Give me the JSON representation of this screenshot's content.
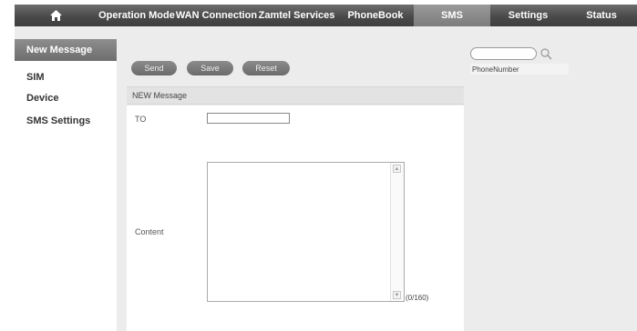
{
  "nav": {
    "items": [
      {
        "label": "Operation Mode"
      },
      {
        "label": "WAN Connection"
      },
      {
        "label": "Zamtel Services"
      },
      {
        "label": "PhoneBook"
      },
      {
        "label": "SMS"
      },
      {
        "label": "Settings"
      },
      {
        "label": "Status"
      }
    ],
    "active_index": 4
  },
  "sidebar": {
    "items": [
      {
        "label": "New Message"
      },
      {
        "label": "SIM"
      },
      {
        "label": "Device"
      },
      {
        "label": "SMS Settings"
      }
    ],
    "active_index": 0
  },
  "toolbar": {
    "send_label": "Send",
    "save_label": "Save",
    "reset_label": "Reset"
  },
  "form": {
    "section_title": "NEW Message",
    "to_label": "TO",
    "to_value": "",
    "content_label": "Content",
    "content_value": "",
    "char_counter": "(0/160)"
  },
  "phonebook_panel": {
    "search_value": "",
    "column_header": "PhoneNumber"
  },
  "colors": {
    "nav_bg": "#4a4a4a",
    "nav_active": "#8c8c8c",
    "page_bg": "#ececec"
  }
}
